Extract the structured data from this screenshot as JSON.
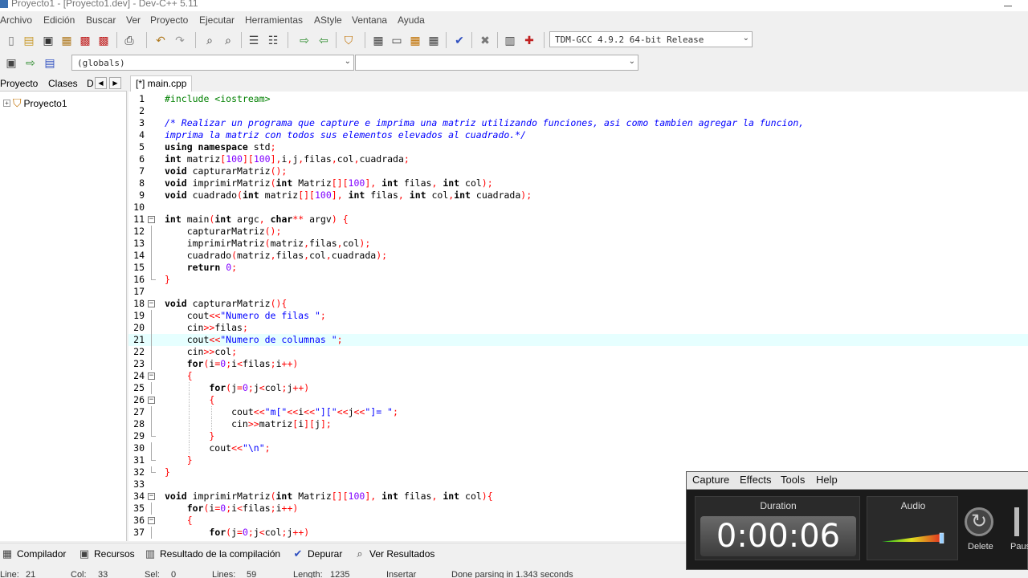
{
  "window": {
    "title": "Proyecto1 - [Proyecto1.dev] - Dev-C++ 5.11"
  },
  "menu": [
    "Archivo",
    "Edición",
    "Buscar",
    "Ver",
    "Proyecto",
    "Ejecutar",
    "Herramientas",
    "AStyle",
    "Ventana",
    "Ayuda"
  ],
  "toolbar": {
    "compiler_select": "TDM-GCC 4.9.2 64-bit Release",
    "scope_select": "(globals)",
    "member_select": "",
    "icons": [
      "new-file-icon",
      "open-icon",
      "save-icon",
      "save-all-icon",
      "close-icon",
      "close-all-icon",
      "print-icon",
      "undo-icon",
      "redo-icon",
      "find-icon",
      "replace-icon",
      "indent-icon",
      "unindent-icon",
      "goto-icon",
      "bookmark-icon",
      "badge-icon",
      "compile-icon",
      "run-icon",
      "compile-run-icon",
      "rebuild-icon",
      "syntax-check-icon",
      "delete-icon",
      "chart-icon",
      "debug-icon"
    ]
  },
  "left_panel": {
    "tabs": [
      "Proyecto",
      "Clases",
      "D"
    ],
    "tree_root": "Proyecto1"
  },
  "editor": {
    "tab": "[*] main.cpp",
    "highlighted_line": 21
  },
  "bottom_tabs": [
    "Compilador",
    "Recursos",
    "Resultado de la compilación",
    "Depurar",
    "Ver Resultados"
  ],
  "status": {
    "line": "Line:",
    "line_val": "21",
    "col": "Col:",
    "col_val": "33",
    "sel": "Sel:",
    "sel_val": "0",
    "lines": "Lines:",
    "lines_val": "59",
    "length": "Length:",
    "length_val": "1235",
    "mode": "Insertar",
    "message": "Done parsing in 1.343 seconds"
  },
  "recorder": {
    "menu": [
      "Capture",
      "Effects",
      "Tools",
      "Help"
    ],
    "duration_label": "Duration",
    "duration": "0:00:06",
    "audio_label": "Audio",
    "delete_label": "Delete",
    "pause_label": "Paus"
  }
}
